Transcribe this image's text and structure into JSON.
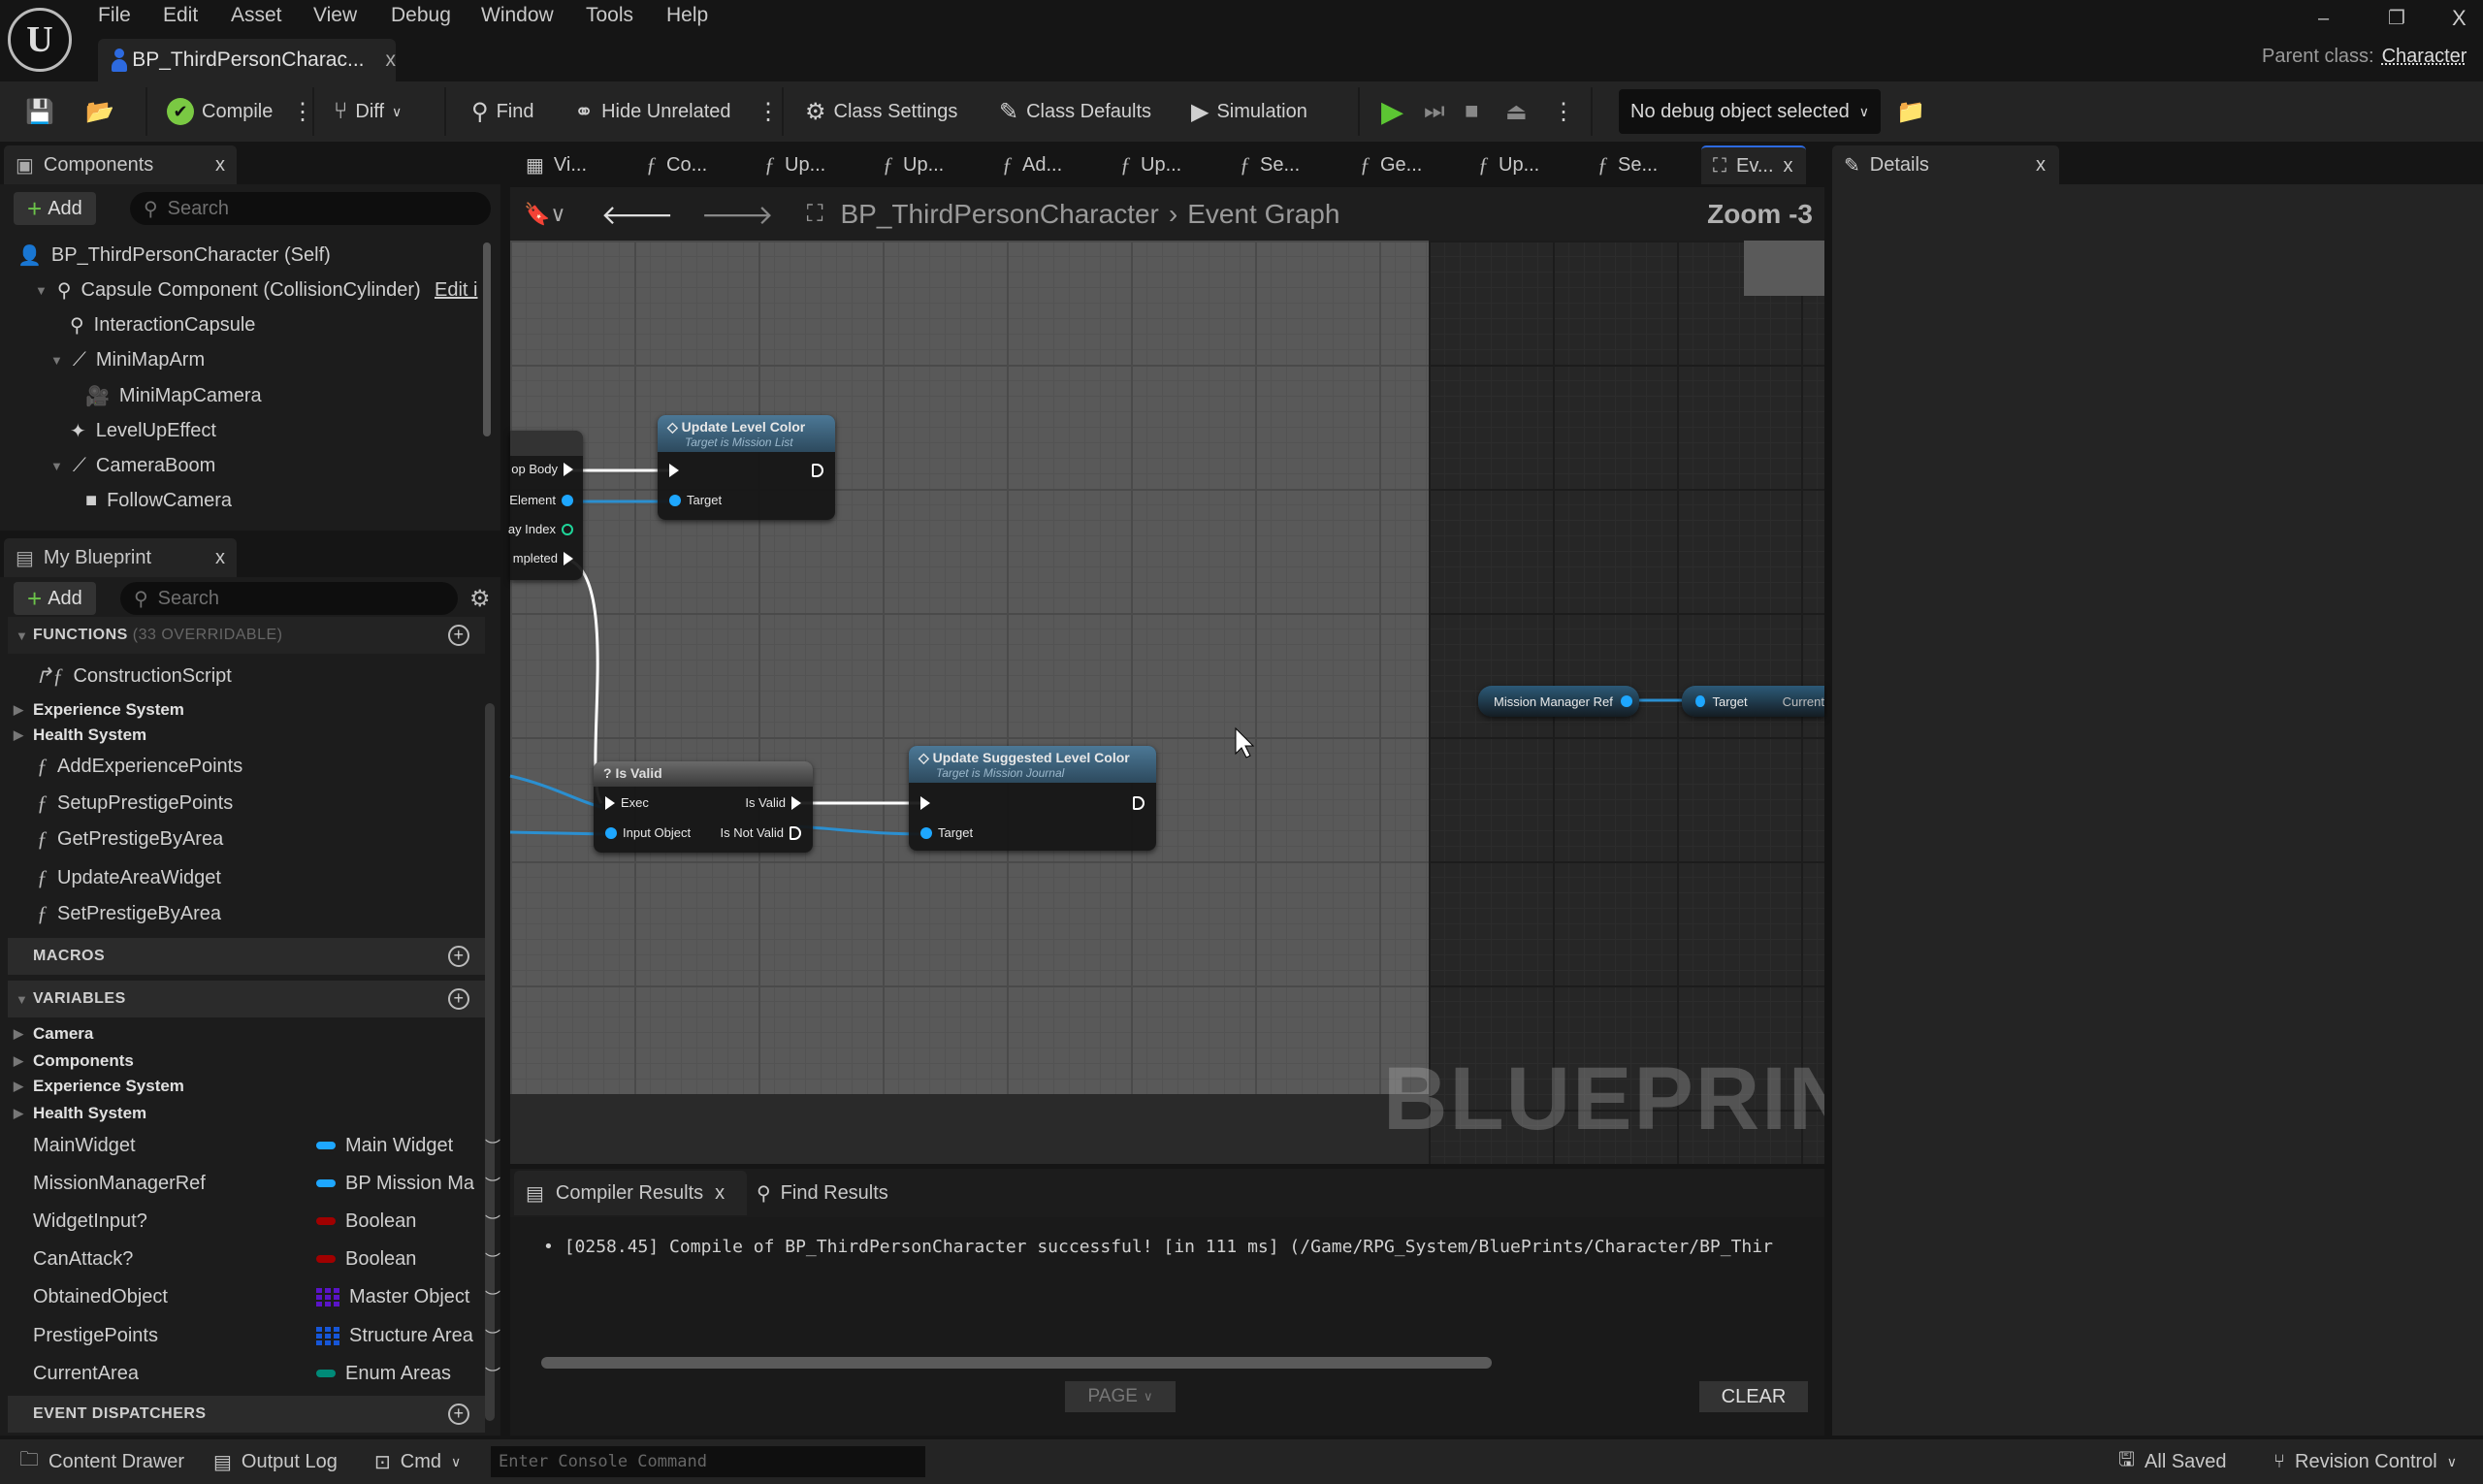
{
  "menu": [
    "File",
    "Edit",
    "Asset",
    "View",
    "Debug",
    "Window",
    "Tools",
    "Help"
  ],
  "logo": "U",
  "doc_tab": {
    "title": "BP_ThirdPersonCharac...",
    "close": "x"
  },
  "parent_class": {
    "label": "Parent class:",
    "value": "Character"
  },
  "window_controls": {
    "minimize": "–",
    "restore": "❐",
    "close": "X"
  },
  "toolbar": {
    "compile": "Compile",
    "diff": "Diff",
    "find": "Find",
    "hide_unrelated": "Hide Unrelated",
    "class_settings": "Class Settings",
    "class_defaults": "Class Defaults",
    "simulation": "Simulation",
    "debug_object": "No debug object selected"
  },
  "components_panel": {
    "tab": "Components",
    "close": "x",
    "add": "Add",
    "search_placeholder": "Search",
    "items": [
      {
        "label": "BP_ThirdPersonCharacter (Self)"
      },
      {
        "label": "Capsule Component (CollisionCylinder)",
        "action": "Edit i"
      },
      {
        "label": "InteractionCapsule"
      },
      {
        "label": "MiniMapArm"
      },
      {
        "label": "MiniMapCamera"
      },
      {
        "label": "LevelUpEffect"
      },
      {
        "label": "CameraBoom"
      },
      {
        "label": "FollowCamera"
      }
    ]
  },
  "my_blueprint": {
    "tab": "My Blueprint",
    "close": "x",
    "add": "Add",
    "search_placeholder": "Search",
    "functions_header": "FUNCTIONS",
    "functions_note": "(33 OVERRIDABLE)",
    "functions": [
      "ConstructionScript",
      "Experience System",
      "Health System",
      "AddExperiencePoints",
      "SetupPrestigePoints",
      "GetPrestigeByArea",
      "UpdateAreaWidget",
      "SetPrestigeByArea"
    ],
    "macros_header": "MACROS",
    "variables_header": "VARIABLES",
    "variable_categories": [
      "Camera",
      "Components",
      "Experience System",
      "Health System"
    ],
    "variables": [
      {
        "name": "MainWidget",
        "type": "Main Widget",
        "color": "#1ea7ff"
      },
      {
        "name": "MissionManagerRef",
        "type": "BP Mission Ma",
        "color": "#1ea7ff"
      },
      {
        "name": "WidgetInput?",
        "type": "Boolean",
        "color": "#a00000"
      },
      {
        "name": "CanAttack?",
        "type": "Boolean",
        "color": "#a00000"
      },
      {
        "name": "ObtainedObject",
        "type": "Master Object",
        "color": "#5a14c8"
      },
      {
        "name": "PrestigePoints",
        "type": "Structure Area",
        "color": "#1656d8"
      },
      {
        "name": "CurrentArea",
        "type": "Enum Areas",
        "color": "#008a78"
      }
    ],
    "dispatchers_header": "EVENT DISPATCHERS"
  },
  "graph_tabs": [
    "Vi...",
    "Co...",
    "Up...",
    "Up...",
    "Ad...",
    "Up...",
    "Se...",
    "Ge...",
    "Up...",
    "Se...",
    "Ev..."
  ],
  "graph_tab_close": "x",
  "details_tab": {
    "label": "Details",
    "close": "x"
  },
  "breadcrumb": {
    "root": "BP_ThirdPersonCharacter",
    "current": "Event Graph"
  },
  "zoom_label": "Zoom -3",
  "watermark": "BLUEPRINT",
  "nodes": {
    "loop": {
      "pins": [
        "op Body",
        "Element",
        "ay Index",
        "mpleted"
      ]
    },
    "update_level_color": {
      "title": "Update Level Color",
      "subtitle": "Target is Mission List",
      "target": "Target"
    },
    "is_valid": {
      "title": "Is Valid",
      "exec": "Exec",
      "input": "Input Object",
      "valid": "Is Valid",
      "not_valid": "Is Not Valid"
    },
    "update_suggested": {
      "title": "Update Suggested Level Color",
      "subtitle": "Target is Mission Journal",
      "target": "Target"
    },
    "mission_manager_ref": {
      "title": "Mission Manager Ref"
    },
    "getter": {
      "target": "Target",
      "output": "Current"
    }
  },
  "bottom_panel": {
    "tabs": [
      "Compiler Results",
      "Find Results"
    ],
    "close": "x",
    "log": "[0258.45] Compile of BP_ThirdPersonCharacter successful! [in 111 ms] (/Game/RPG_System/BluePrints/Character/BP_Thir",
    "page": "PAGE",
    "clear": "CLEAR"
  },
  "statusbar": {
    "content_drawer": "Content Drawer",
    "output_log": "Output Log",
    "cmd": "Cmd",
    "console_placeholder": "Enter Console Command",
    "all_saved": "All Saved",
    "revision_control": "Revision Control"
  }
}
